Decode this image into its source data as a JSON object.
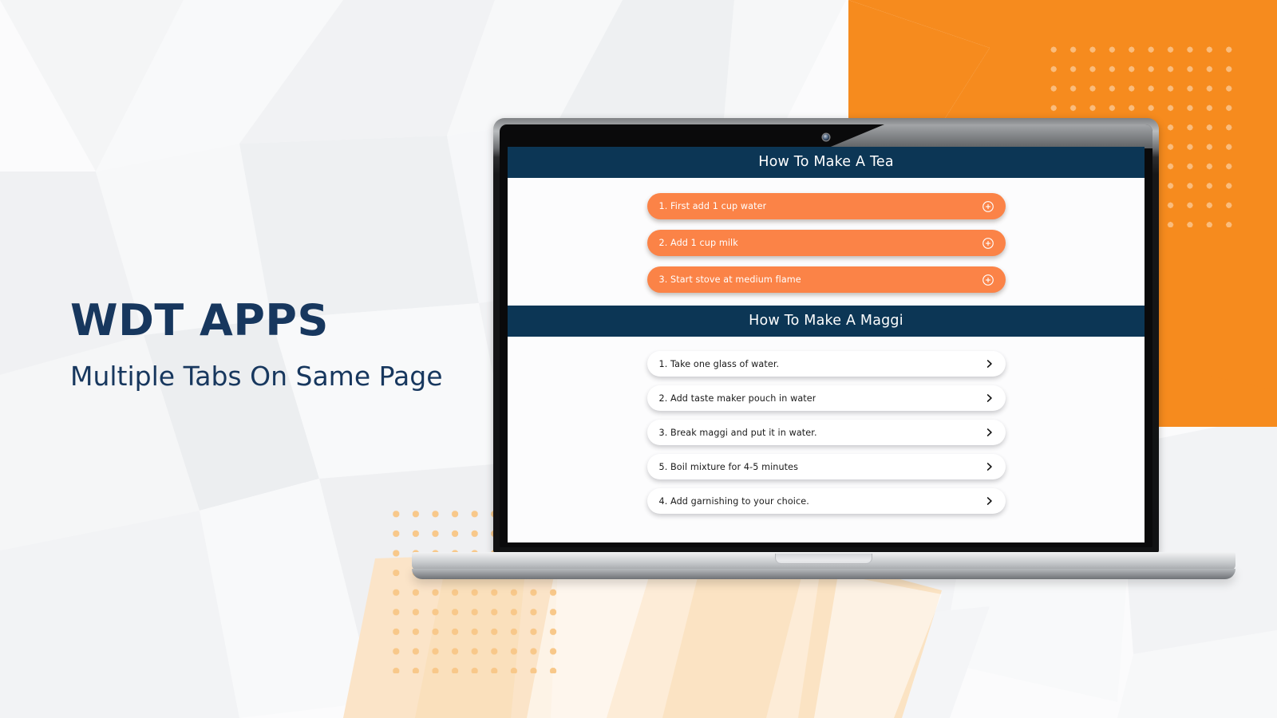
{
  "banner": {
    "title": "WDT APPS",
    "subtitle": "Multiple Tabs On Same Page"
  },
  "colors": {
    "brand_orange": "#f68b1e",
    "accent_orange": "#fb8347",
    "navy": "#0c3655",
    "headline_navy": "#17375e",
    "dot_peach": "#f8c88a",
    "screen_bg": "#fcfcfd"
  },
  "device": {
    "type": "laptop",
    "webcam_icon": "webcam-dot-icon"
  },
  "screen": {
    "sections": [
      {
        "id": "tea",
        "title": "How To Make A Tea",
        "style": "orange",
        "icon": "plus-circle-icon",
        "items": [
          {
            "label": "1. First add 1 cup water"
          },
          {
            "label": "2. Add 1 cup milk"
          },
          {
            "label": "3. Start stove at medium flame"
          }
        ]
      },
      {
        "id": "maggi",
        "title": "How To Make A Maggi",
        "style": "white",
        "icon": "chevron-right-icon",
        "items": [
          {
            "label": "1. Take one glass of water."
          },
          {
            "label": "2. Add taste maker pouch in water"
          },
          {
            "label": "3. Break maggi and put it in water."
          },
          {
            "label": "5. Boil mixture for 4-5 minutes"
          },
          {
            "label": "4. Add garnishing to your choice."
          }
        ]
      }
    ]
  }
}
